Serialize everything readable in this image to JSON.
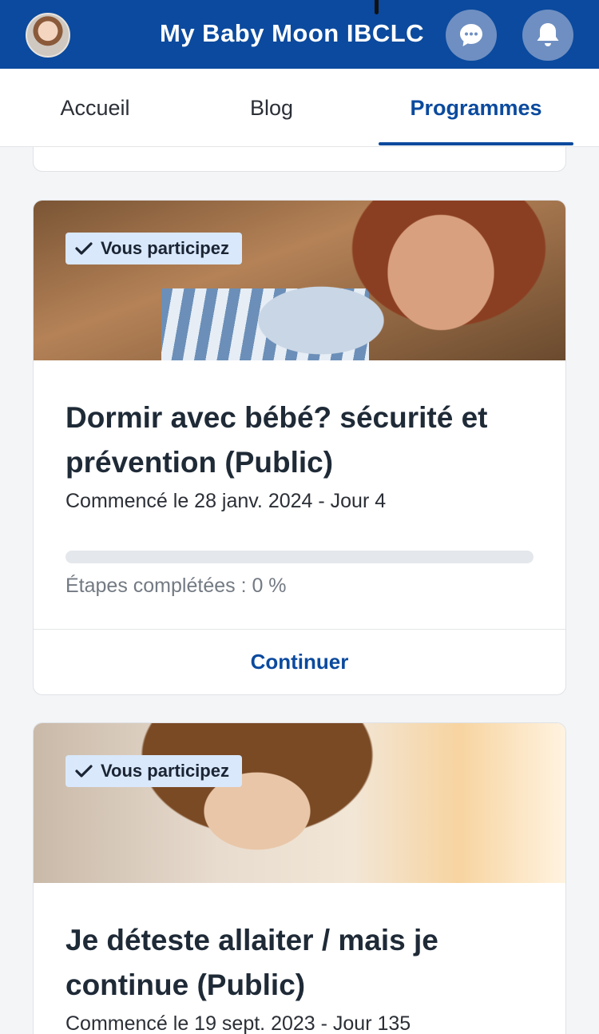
{
  "header": {
    "title": "My Baby Moon IBCLC",
    "chat_icon": "chat-bubble-icon",
    "bell_icon": "bell-icon",
    "accent": "#0b4a9e"
  },
  "tabs": [
    {
      "label": "Accueil",
      "active": false
    },
    {
      "label": "Blog",
      "active": false
    },
    {
      "label": "Programmes",
      "active": true
    }
  ],
  "programs": [
    {
      "badge": "Vous participez",
      "title": "Dormir avec bébé? sécurité  et prévention (Public)",
      "started": "Commencé le 28 janv. 2024 - Jour 4",
      "progress_percent": 0,
      "progress_label": "Étapes complétées : 0 %",
      "button": "Continuer"
    },
    {
      "badge": "Vous participez",
      "title": "Je déteste allaiter / mais je continue (Public)",
      "started": "Commencé le 19 sept. 2023 - Jour 135"
    }
  ]
}
